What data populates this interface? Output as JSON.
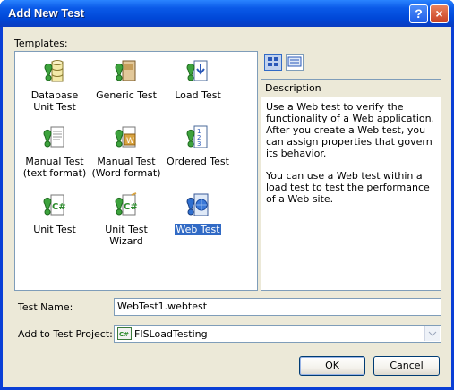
{
  "window": {
    "title": "Add New Test"
  },
  "titlebar": {
    "help_label": "?",
    "close_label": "×"
  },
  "templates": {
    "label": "Templates:",
    "items": [
      {
        "label": "Database Unit Test",
        "icon": "database-unit-test-icon"
      },
      {
        "label": "Generic Test",
        "icon": "generic-test-icon"
      },
      {
        "label": "Load Test",
        "icon": "load-test-icon"
      },
      {
        "label": "Manual Test (text format)",
        "icon": "manual-test-text-icon"
      },
      {
        "label": "Manual Test (Word format)",
        "icon": "manual-test-word-icon"
      },
      {
        "label": "Ordered Test",
        "icon": "ordered-test-icon"
      },
      {
        "label": "Unit Test",
        "icon": "unit-test-icon"
      },
      {
        "label": "Unit Test Wizard",
        "icon": "unit-test-wizard-icon"
      },
      {
        "label": "Web Test",
        "icon": "web-test-icon",
        "selected": true
      }
    ]
  },
  "description": {
    "header": "Description",
    "paragraph1": "Use a Web test to verify the functionality of a Web application. After you create a Web test, you can assign properties that govern its behavior.",
    "paragraph2": "You can use a Web test within a load test to test the performance of a Web site."
  },
  "form": {
    "test_name_label": "Test Name:",
    "test_name_value": "WebTest1.webtest",
    "project_label": "Add to Test Project:",
    "project_value": "FISLoadTesting"
  },
  "buttons": {
    "ok": "OK",
    "cancel": "Cancel"
  },
  "colors": {
    "selection": "#316ac5",
    "titlebar": "#0a5ae8",
    "client": "#ece9d8"
  }
}
